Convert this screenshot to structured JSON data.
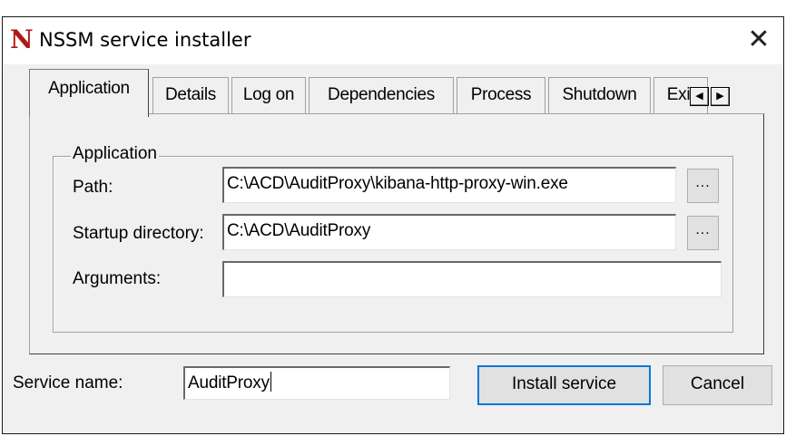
{
  "window": {
    "title": "NSSM service installer",
    "app_icon_letter": "N",
    "close_glyph": "✕"
  },
  "tabs": [
    {
      "label": "Application",
      "active": true
    },
    {
      "label": "Details"
    },
    {
      "label": "Log on"
    },
    {
      "label": "Dependencies"
    },
    {
      "label": "Process"
    },
    {
      "label": "Shutdown"
    },
    {
      "label": "Exit"
    }
  ],
  "tab_scroll": {
    "left_icon": "◀",
    "right_icon": "▶"
  },
  "application_group": {
    "legend": "Application",
    "path_label": "Path:",
    "path_value": "C:\\ACD\\AuditProxy\\kibana-http-proxy-win.exe",
    "startup_label": "Startup directory:",
    "startup_value": "C:\\ACD\\AuditProxy",
    "arguments_label": "Arguments:",
    "arguments_value": "",
    "browse_label": "..."
  },
  "footer": {
    "service_name_label": "Service name:",
    "service_name_value": "AuditProxy",
    "install_label": "Install service",
    "cancel_label": "Cancel"
  },
  "colors": {
    "window_bg": "#f0f0f0",
    "icon_red": "#b01818",
    "default_button_border": "#0078d7"
  }
}
